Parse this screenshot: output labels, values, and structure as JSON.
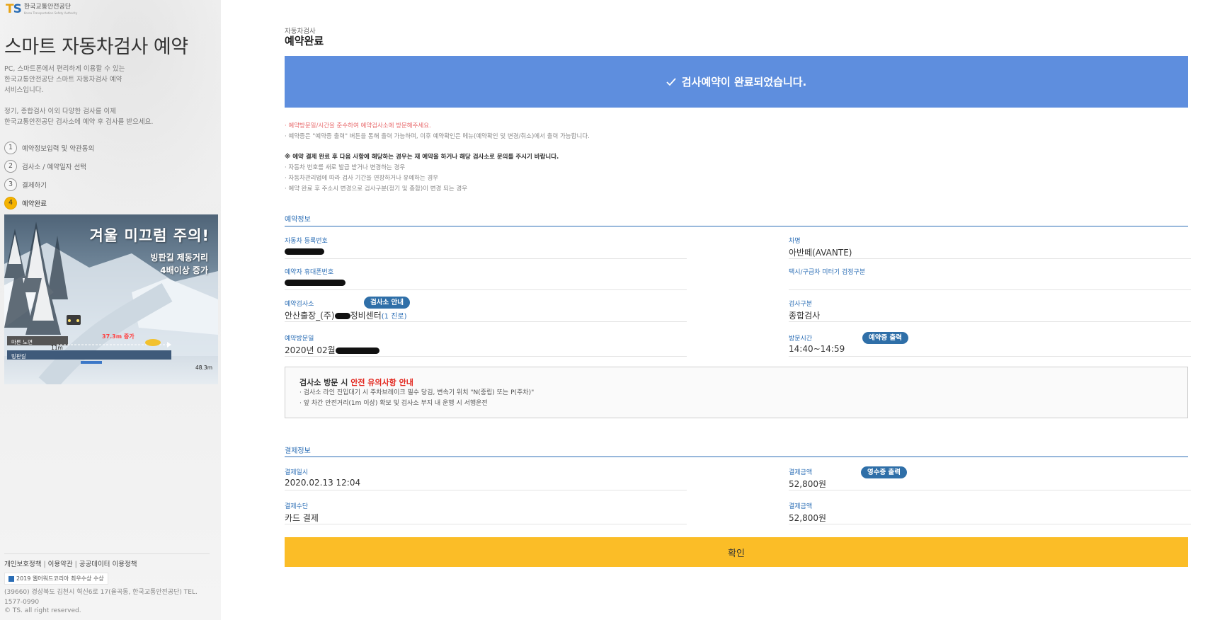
{
  "sidebar": {
    "logo_mark": "TS",
    "logo_text": "한국교통안전공단",
    "logo_subtext": "Korea Transportation Safety Authority",
    "title": "스마트 자동차검사 예약",
    "desc1": [
      "PC, 스마트폰에서 편리하게 이용할 수 있는",
      "한국교통안전공단 스마트 자동차검사 예약",
      "서비스입니다."
    ],
    "desc2": [
      "정기, 종합검사 이외 다양한 검사를 이제",
      "한국교통안전공단 검사소에 예약 후 검사를 받으세요."
    ],
    "steps": [
      {
        "num": "1",
        "label": "예약정보입력 및 약관동의"
      },
      {
        "num": "2",
        "label": "검사소 / 예약일자 선택"
      },
      {
        "num": "3",
        "label": "결제하기"
      },
      {
        "num": "4",
        "label": "예약완료",
        "active": true
      }
    ],
    "banner": {
      "title": "겨울 미끄럼 주의!",
      "line1": "빙판길 제동거리",
      "line2": "4배이상 증가",
      "dry_label": "마른 노면",
      "ice_label": "빙판길",
      "dist_dry": "11m",
      "dist_increase": "37.3m 증가",
      "dist_ice": "48.3m"
    },
    "footer": {
      "links": [
        "개인보호정책",
        "이용약관",
        "공공데이터 이용정책"
      ],
      "award": "2019 웹어워드코리아 최우수상 수상",
      "address": "(39660) 경상북도 김천시 혁신6로 17(율곡동, 한국교통안전공단) TEL. 1577-0990",
      "copyright": "© TS. all right reserved."
    }
  },
  "main": {
    "breadcrumb": "자동차검사",
    "title": "예약완료",
    "done_message": "검사예약이 완료되었습니다.",
    "notes": {
      "red": "· 예약방문일/시간을 준수하여 예약검사소에 방문해주세요.",
      "gray": "· 예약증은 \"예약증 출력\" 버튼을 통해 출력 가능하며, 이후 예약확인은 메뉴(예약확인 및 변경/취소)에서 출력 가능합니다.",
      "bold": "※ 예약 결제 완료 후 다음 사항에 해당하는 경우는 재 예약을 하거나 해당 검사소로 문의를 주시기 바랍니다.",
      "items": [
        "· 자동차 번호를 새로 발급 받거나 변경하는 경우",
        "· 자동차관리법에 따라 검사 기간을 연장하거나 유예하는 경우",
        "· 예약 완료 후 주소시 변경으로 검사구분(정기 및 종합)이 변경 되는 경우"
      ]
    },
    "reservation": {
      "section_title": "예약정보",
      "car_number_label": "자동차 등록번호",
      "car_name_label": "차명",
      "car_name": "아반떼(AVANTE)",
      "phone_label": "예약자 휴대폰번호",
      "taxi_label": "택시/구급차 미터기 검정구분",
      "taxi_value": "",
      "center_label": "예약검사소",
      "center_button": "검사소 안내",
      "center_prefix": "안산출장_(주)",
      "center_suffix": "정비센터",
      "center_hall": "(1 진로)",
      "type_label": "검사구분",
      "type_value": "종합검사",
      "date_label": "예약방문일",
      "date_prefix": "2020년 02월",
      "time_label": "방문시간",
      "print_button": "예약증 출력",
      "time_value": "14:40~14:59"
    },
    "safety": {
      "title_prefix": "검사소 방문 시 ",
      "title_red": "안전 유의사항 안내",
      "items": [
        "· 검사소 라인 진입대기 시 주차브레이크 필수 당김, 변속기 위치 \"N(중립) 또는 P(주차)\"",
        "· 앞 차간 안전거리(1m 이상) 확보 및 검사소 부지 내 운행 시 서행운전"
      ]
    },
    "payment": {
      "section_title": "결제정보",
      "datetime_label": "결제일시",
      "datetime_value": "2020.02.13 12:04",
      "amount_label": "결제금액",
      "receipt_button": "영수증 출력",
      "amount_value": "52,800원",
      "method_label": "결제수단",
      "method_value": "카드 결제",
      "amount2_label": "결제금액",
      "amount2_value": "52,800원"
    },
    "confirm_button": "확인"
  },
  "colors": {
    "accent_blue": "#5e8ede",
    "label_blue": "#2a6db5",
    "pill_blue": "#2f6fa8",
    "confirm_yellow": "#fbbd27",
    "active_step": "#f5b300",
    "warning_red": "#e2231a"
  }
}
